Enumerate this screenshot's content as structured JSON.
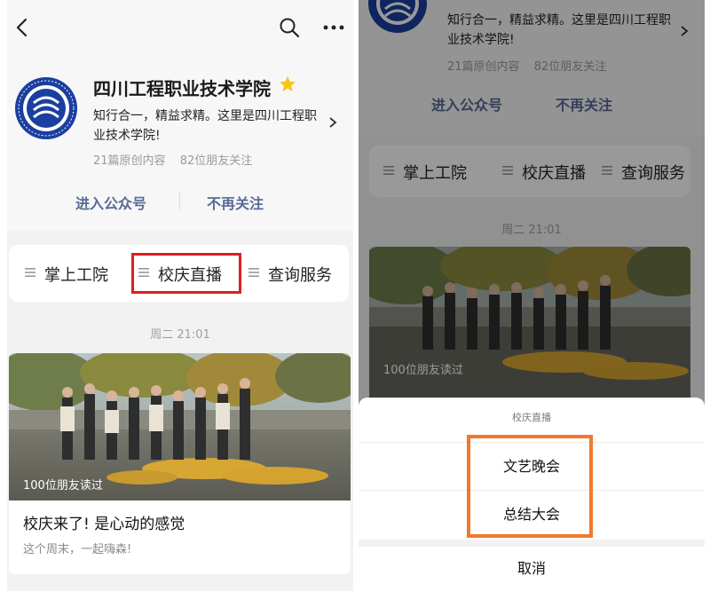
{
  "left": {
    "account": {
      "name": "四川工程职业技术学院",
      "description": "知行合一，精益求精。这里是四川工程职业技术学院!",
      "stats": [
        "21篇原创内容",
        "82位朋友关注"
      ]
    },
    "actions": {
      "enter": "进入公众号",
      "unfollow": "不再关注"
    },
    "menu": [
      "掌上工院",
      "校庆直播",
      "查询服务"
    ],
    "timestamp": "周二 21:01",
    "article": {
      "read_count": "100位朋友读过",
      "title": "校庆来了! 是心动的感觉",
      "subtitle": "这个周末，一起嗨森!"
    }
  },
  "right": {
    "account": {
      "description": "知行合一，精益求精。这里是四川工程职业技术学院!",
      "stats": [
        "21篇原创内容",
        "82位朋友关注"
      ]
    },
    "actions": {
      "enter": "进入公众号",
      "unfollow": "不再关注"
    },
    "menu": [
      "掌上工院",
      "校庆直播",
      "查询服务"
    ],
    "timestamp": "周二 21:01",
    "article": {
      "read_count": "100位朋友读过"
    },
    "sheet": {
      "title": "校庆直播",
      "options": [
        "文艺晚会",
        "总结大会"
      ],
      "cancel": "取消"
    }
  },
  "colors": {
    "link": "#576b95",
    "highlight_red": "#e01e1e",
    "highlight_orange": "#f07a2a",
    "logo_blue": "#1b3fa0",
    "star": "#f5c518"
  },
  "icons": {
    "back": "chevron-left-icon",
    "search": "search-icon",
    "more": "more-dots-icon",
    "verified": "star-icon",
    "menu": "hamburger-icon",
    "description": "chevron-right-icon"
  }
}
